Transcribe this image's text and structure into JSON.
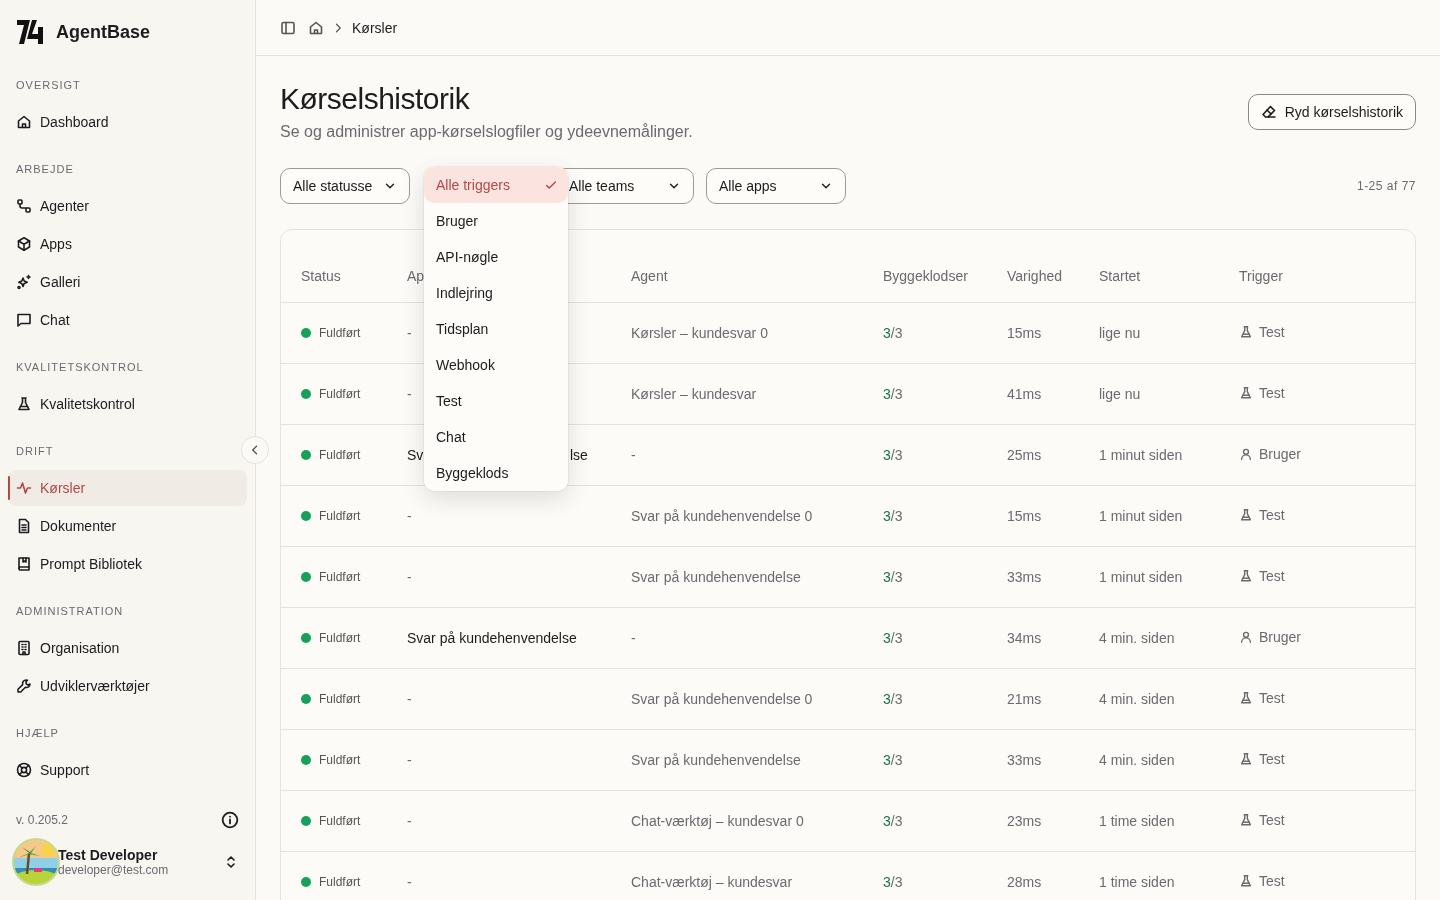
{
  "sidebar": {
    "brand": "AgentBase",
    "sections": [
      {
        "heading": "OVERSIGT",
        "items": [
          {
            "label": "Dashboard",
            "selected": false
          }
        ]
      },
      {
        "heading": "ARBEJDE",
        "items": [
          {
            "label": "Agenter",
            "selected": false
          },
          {
            "label": "Apps",
            "selected": false
          },
          {
            "label": "Galleri",
            "selected": false
          },
          {
            "label": "Chat",
            "selected": false
          }
        ]
      },
      {
        "heading": "KVALITETSKONTROL",
        "items": [
          {
            "label": "Kvalitetskontrol",
            "selected": false
          }
        ]
      },
      {
        "heading": "DRIFT",
        "items": [
          {
            "label": "Kørsler",
            "selected": true
          },
          {
            "label": "Dokumenter",
            "selected": false
          },
          {
            "label": "Prompt Bibliotek",
            "selected": false
          }
        ]
      },
      {
        "heading": "ADMINISTRATION",
        "items": [
          {
            "label": "Organisation",
            "selected": false
          },
          {
            "label": "Udviklerværktøjer",
            "selected": false
          }
        ]
      },
      {
        "heading": "HJÆLP",
        "items": [
          {
            "label": "Support",
            "selected": false
          }
        ]
      }
    ],
    "version": "v. 0.205.2",
    "user": {
      "name": "Test Developer",
      "email": "developer@test.com"
    }
  },
  "breadcrumb": {
    "current": "Kørsler"
  },
  "page": {
    "title": "Kørselshistorik",
    "subtitle": "Se og administrer app-kørselslogfiler og ydeevnemålinger.",
    "clear_button": "Ryd kørselshistorik"
  },
  "filters": [
    {
      "label": "Alle statusse"
    },
    {
      "label": "Alle teams"
    },
    {
      "label": "Alle apps"
    }
  ],
  "trigger_menu": {
    "options": [
      {
        "label": "Alle triggers",
        "selected": true
      },
      {
        "label": "Bruger",
        "selected": false
      },
      {
        "label": "API-nøgle",
        "selected": false
      },
      {
        "label": "Indlejring",
        "selected": false
      },
      {
        "label": "Tidsplan",
        "selected": false
      },
      {
        "label": "Webhook",
        "selected": false
      },
      {
        "label": "Test",
        "selected": false
      },
      {
        "label": "Chat",
        "selected": false
      },
      {
        "label": "Byggeklods",
        "selected": false
      }
    ]
  },
  "pagination": "1-25 af 77",
  "table": {
    "columns": [
      "Status",
      "Ap",
      "Agent",
      "Byggeklodser",
      "Varighed",
      "Startet",
      "Trigger"
    ],
    "rows": [
      {
        "status": {
          "label": "Fuldført",
          "kind": "done"
        },
        "app": "-",
        "agent": "Kørsler – kundesvar 0",
        "blocks_done": "3",
        "blocks_rest": "/3",
        "duration": "15ms",
        "started": "lige nu",
        "trigger": {
          "label": "Test",
          "kind": "test"
        }
      },
      {
        "status": {
          "label": "Fuldført",
          "kind": "done"
        },
        "app": "-",
        "agent": "Kørsler – kundesvar",
        "blocks_done": "3",
        "blocks_rest": "/3",
        "duration": "41ms",
        "started": "lige nu",
        "trigger": {
          "label": "Test",
          "kind": "test"
        }
      },
      {
        "status": {
          "label": "Fuldført",
          "kind": "done"
        },
        "app": "Sv",
        "app_tail": "lse",
        "agent": "-",
        "blocks_done": "3",
        "blocks_rest": "/3",
        "duration": "25ms",
        "started": "1 minut siden",
        "trigger": {
          "label": "Bruger",
          "kind": "user"
        }
      },
      {
        "status": {
          "label": "Fuldført",
          "kind": "done"
        },
        "app": "-",
        "agent": "Svar på kundehenvendelse 0",
        "blocks_done": "3",
        "blocks_rest": "/3",
        "duration": "15ms",
        "started": "1 minut siden",
        "trigger": {
          "label": "Test",
          "kind": "test"
        }
      },
      {
        "status": {
          "label": "Fuldført",
          "kind": "done"
        },
        "app": "-",
        "agent": "Svar på kundehenvendelse",
        "blocks_done": "3",
        "blocks_rest": "/3",
        "duration": "33ms",
        "started": "1 minut siden",
        "trigger": {
          "label": "Test",
          "kind": "test"
        }
      },
      {
        "status": {
          "label": "Fuldført",
          "kind": "done"
        },
        "app": "Svar på kundehenvendelse",
        "agent": "-",
        "blocks_done": "3",
        "blocks_rest": "/3",
        "duration": "34ms",
        "started": "4 min. siden",
        "trigger": {
          "label": "Bruger",
          "kind": "user"
        }
      },
      {
        "status": {
          "label": "Fuldført",
          "kind": "done"
        },
        "app": "-",
        "agent": "Svar på kundehenvendelse 0",
        "blocks_done": "3",
        "blocks_rest": "/3",
        "duration": "21ms",
        "started": "4 min. siden",
        "trigger": {
          "label": "Test",
          "kind": "test"
        }
      },
      {
        "status": {
          "label": "Fuldført",
          "kind": "done"
        },
        "app": "-",
        "agent": "Svar på kundehenvendelse",
        "blocks_done": "3",
        "blocks_rest": "/3",
        "duration": "33ms",
        "started": "4 min. siden",
        "trigger": {
          "label": "Test",
          "kind": "test"
        }
      },
      {
        "status": {
          "label": "Fuldført",
          "kind": "done"
        },
        "app": "-",
        "agent": "Chat-værktøj – kundesvar 0",
        "blocks_done": "3",
        "blocks_rest": "/3",
        "duration": "23ms",
        "started": "1 time siden",
        "trigger": {
          "label": "Test",
          "kind": "test"
        }
      },
      {
        "status": {
          "label": "Fuldført",
          "kind": "done"
        },
        "app": "-",
        "agent": "Chat-værktøj – kundesvar",
        "blocks_done": "3",
        "blocks_rest": "/3",
        "duration": "28ms",
        "started": "1 time siden",
        "trigger": {
          "label": "Test",
          "kind": "test"
        }
      }
    ]
  }
}
